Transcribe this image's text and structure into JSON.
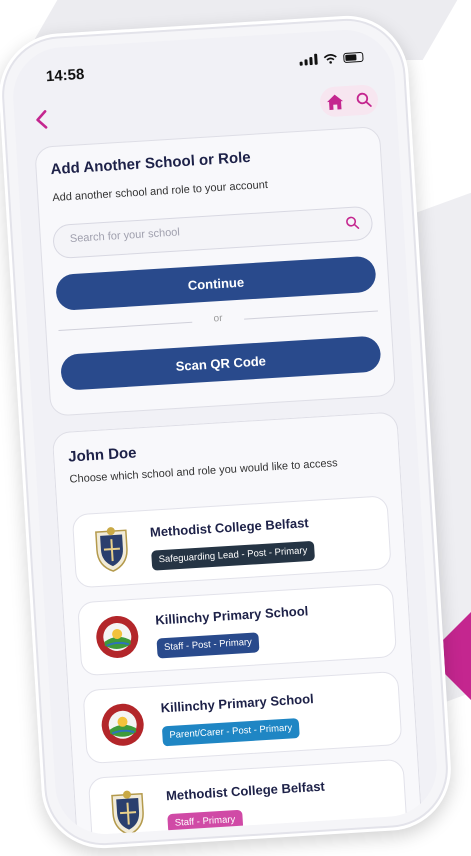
{
  "colors": {
    "accent": "#c4268f",
    "primary_button": "#294a8c",
    "title_text": "#1d2148"
  },
  "status_bar": {
    "time": "14:58"
  },
  "nav": {
    "back_icon": "chevron-left-icon",
    "home_icon": "home-icon",
    "search_icon": "search-icon"
  },
  "add_school": {
    "title": "Add Another School or Role",
    "subtitle": "Add another school and role to your account",
    "search_placeholder": "Search for your school",
    "continue_label": "Continue",
    "divider_label": "or",
    "scan_label": "Scan QR Code"
  },
  "user": {
    "name": "John Doe",
    "instructions": "Choose which school and role you would like to access",
    "schools": [
      {
        "name": "Methodist College Belfast",
        "role": "Safeguarding Lead - Post - Primary",
        "badge_color": "#253444",
        "crest": "methodist-crest-icon"
      },
      {
        "name": "Killinchy Primary School",
        "role": "Staff - Post - Primary",
        "badge_color": "#294a8c",
        "crest": "killinchy-crest-icon"
      },
      {
        "name": "Killinchy Primary School",
        "role": "Parent/Carer - Post - Primary",
        "badge_color": "#1f86c4",
        "crest": "killinchy-crest-icon"
      },
      {
        "name": "Methodist College Belfast",
        "role": "Staff - Primary",
        "badge_color": "#d04aa6",
        "crest": "methodist-crest-icon"
      }
    ]
  }
}
